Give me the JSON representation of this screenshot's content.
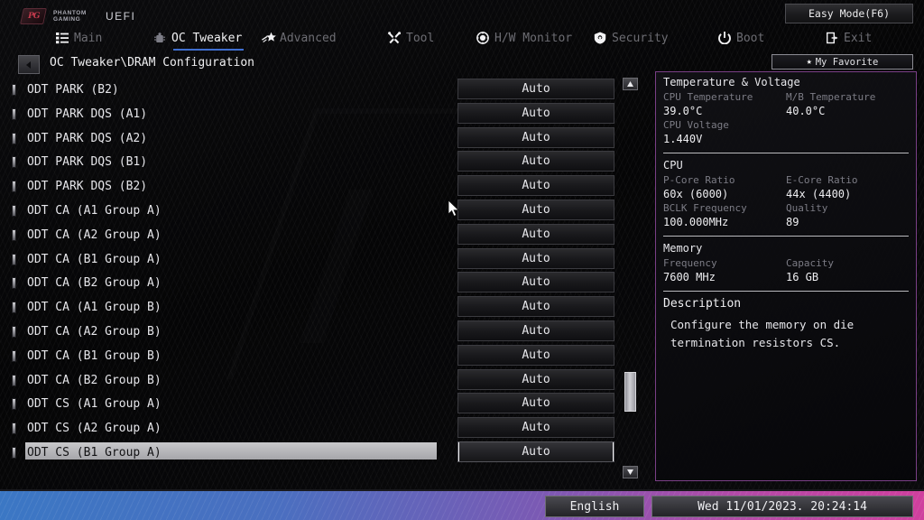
{
  "header": {
    "brand_line1": "PHANTOM",
    "brand_line2": "GAMING",
    "brand_mark": "PG",
    "uefi_label": "UEFI",
    "easy_mode_label": "Easy Mode(F6)",
    "accent_active": "#3f6fd0",
    "panel_border": "#7a3f86",
    "tabs": [
      {
        "label": "Main",
        "icon": "list-icon",
        "active": false
      },
      {
        "label": "OC Tweaker",
        "icon": "chip-icon",
        "active": true
      },
      {
        "label": "Advanced",
        "icon": "rocket-star-icon",
        "active": false
      },
      {
        "label": "Tool",
        "icon": "wrench-icon",
        "active": false
      },
      {
        "label": "H/W Monitor",
        "icon": "gauge-icon",
        "active": false
      },
      {
        "label": "Security",
        "icon": "shield-icon",
        "active": false
      },
      {
        "label": "Boot",
        "icon": "power-icon",
        "active": false
      },
      {
        "label": "Exit",
        "icon": "exit-door-icon",
        "active": false
      }
    ]
  },
  "breadcrumb": {
    "back_icon": "back-arrow-icon",
    "path": "OC Tweaker\\DRAM Configuration",
    "favorite_label": "My Favorite",
    "favorite_icon": "star-icon"
  },
  "settings": {
    "rows": [
      {
        "label": "ODT PARK (B2)",
        "value": "Auto",
        "selected": false
      },
      {
        "label": "ODT PARK DQS (A1)",
        "value": "Auto",
        "selected": false
      },
      {
        "label": "ODT PARK DQS (A2)",
        "value": "Auto",
        "selected": false
      },
      {
        "label": "ODT PARK DQS (B1)",
        "value": "Auto",
        "selected": false
      },
      {
        "label": "ODT PARK DQS (B2)",
        "value": "Auto",
        "selected": false
      },
      {
        "label": "ODT CA (A1 Group A)",
        "value": "Auto",
        "selected": false
      },
      {
        "label": "ODT CA (A2 Group A)",
        "value": "Auto",
        "selected": false
      },
      {
        "label": "ODT CA (B1 Group A)",
        "value": "Auto",
        "selected": false
      },
      {
        "label": "ODT CA (B2 Group A)",
        "value": "Auto",
        "selected": false
      },
      {
        "label": "ODT CA (A1 Group B)",
        "value": "Auto",
        "selected": false
      },
      {
        "label": "ODT CA (A2 Group B)",
        "value": "Auto",
        "selected": false
      },
      {
        "label": "ODT CA (B1 Group B)",
        "value": "Auto",
        "selected": false
      },
      {
        "label": "ODT CA (B2 Group B)",
        "value": "Auto",
        "selected": false
      },
      {
        "label": "ODT CS (A1 Group A)",
        "value": "Auto",
        "selected": false
      },
      {
        "label": "ODT CS (A2 Group A)",
        "value": "Auto",
        "selected": false
      },
      {
        "label": "ODT CS (B1 Group A)",
        "value": "Auto",
        "selected": true
      }
    ],
    "scrollbar": {
      "up_icon": "scroll-up-icon",
      "down_icon": "scroll-down-icon"
    }
  },
  "info_panel": {
    "temp_voltage": {
      "title": "Temperature & Voltage",
      "items": [
        {
          "key": "CPU Temperature",
          "value": "39.0°C"
        },
        {
          "key": "M/B Temperature",
          "value": "40.0°C"
        },
        {
          "key": "CPU Voltage",
          "value": "1.440V"
        }
      ]
    },
    "cpu": {
      "title": "CPU",
      "items": [
        {
          "key": "P-Core Ratio",
          "value": "60x (6000)"
        },
        {
          "key": "E-Core Ratio",
          "value": "44x (4400)"
        },
        {
          "key": "BCLK Frequency",
          "value": "100.000MHz"
        },
        {
          "key": "Quality",
          "value": "89"
        }
      ]
    },
    "memory": {
      "title": "Memory",
      "items": [
        {
          "key": "Frequency",
          "value": "7600 MHz"
        },
        {
          "key": "Capacity",
          "value": "16 GB"
        }
      ]
    },
    "description": {
      "title": "Description",
      "text": "Configure the memory on die termination resistors CS."
    }
  },
  "bottom_bar": {
    "language": "English",
    "datetime": "Wed 11/01/2023. 20:24:14"
  },
  "cursor": {
    "icon": "mouse-pointer-icon"
  }
}
